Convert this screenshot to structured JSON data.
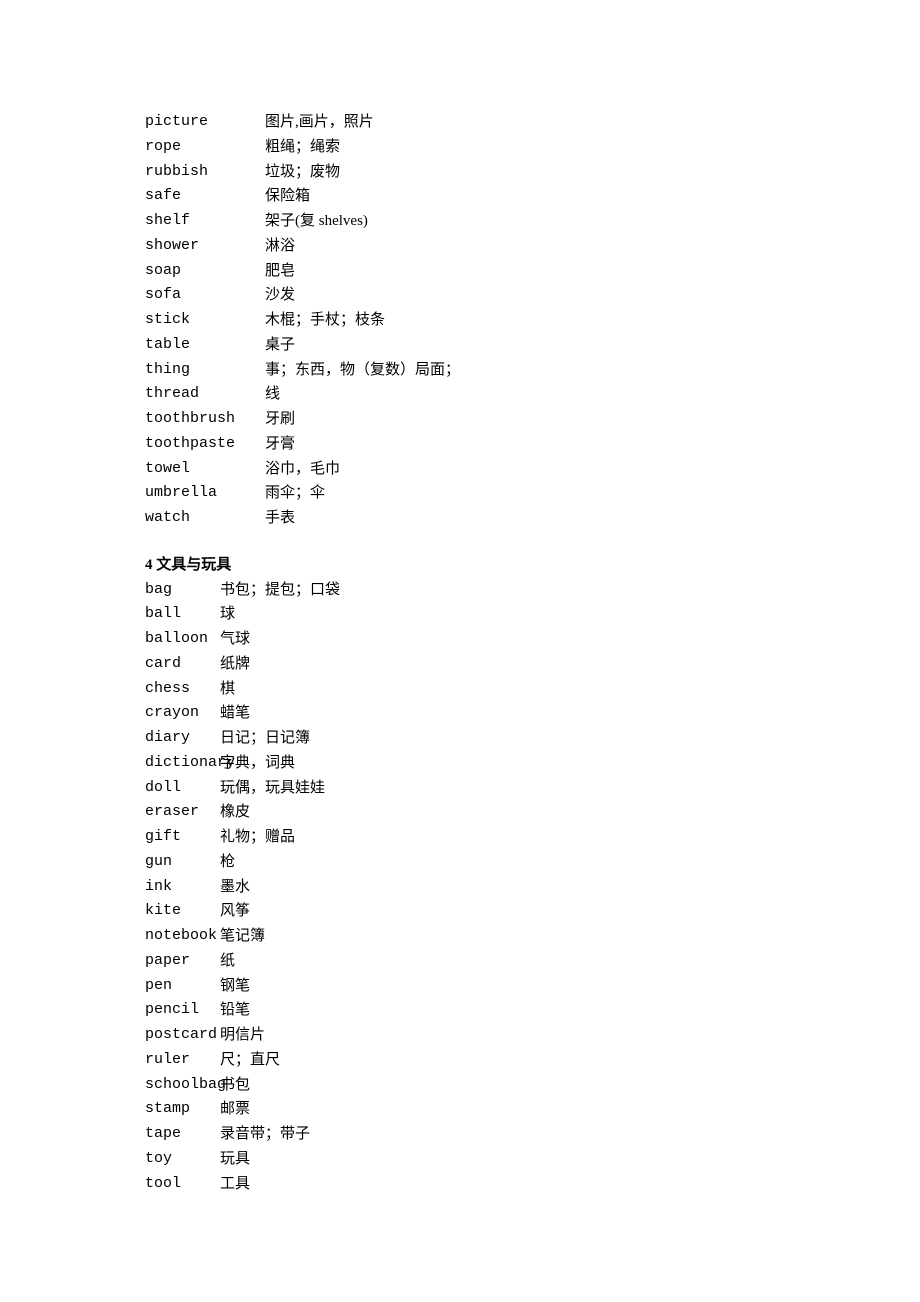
{
  "section1": {
    "entries": [
      {
        "term": "picture",
        "def": "图片,画片，照片"
      },
      {
        "term": "rope",
        "def": "粗绳；绳索"
      },
      {
        "term": "rubbish",
        "def": "垃圾；废物"
      },
      {
        "term": "safe",
        "def": "保险箱"
      },
      {
        "term": "shelf",
        "def": "架子(复 shelves)"
      },
      {
        "term": "shower",
        "def": "淋浴"
      },
      {
        "term": "soap",
        "def": "肥皂"
      },
      {
        "term": "sofa",
        "def": "沙发"
      },
      {
        "term": "stick",
        "def": "木棍；手杖；枝条"
      },
      {
        "term": "table",
        "def": "桌子"
      },
      {
        "term": "thing",
        "def": "事；东西，物（复数）局面；"
      },
      {
        "term": "thread",
        "def": "线"
      },
      {
        "term": "toothbrush",
        "def": "牙刷"
      },
      {
        "term": "toothpaste",
        "def": "牙膏"
      },
      {
        "term": "towel",
        "def": "浴巾，毛巾"
      },
      {
        "term": "umbrella",
        "def": "雨伞；伞"
      },
      {
        "term": "watch",
        "def": "手表"
      }
    ]
  },
  "section2": {
    "heading": "4 文具与玩具",
    "entries": [
      {
        "term": "bag",
        "def": "书包；提包；口袋"
      },
      {
        "term": "ball",
        "def": "球"
      },
      {
        "term": "balloon",
        "def": "气球"
      },
      {
        "term": "card",
        "def": "纸牌"
      },
      {
        "term": "chess",
        "def": "棋"
      },
      {
        "term": "crayon",
        "def": "蜡笔"
      },
      {
        "term": "diary",
        "def": "日记；日记簿"
      },
      {
        "term": "dictionary",
        "def": "字典，词典"
      },
      {
        "term": "doll",
        "def": "玩偶，玩具娃娃"
      },
      {
        "term": "eraser",
        "def": "橡皮"
      },
      {
        "term": "gift",
        "def": "礼物；赠品"
      },
      {
        "term": "gun",
        "def": "枪"
      },
      {
        "term": "ink",
        "def": "墨水"
      },
      {
        "term": "kite",
        "def": "风筝"
      },
      {
        "term": "notebook",
        "def": "笔记簿"
      },
      {
        "term": "paper",
        "def": "纸"
      },
      {
        "term": "pen",
        "def": "钢笔"
      },
      {
        "term": "pencil",
        "def": "铅笔"
      },
      {
        "term": "postcard",
        "def": "明信片"
      },
      {
        "term": "ruler",
        "def": "尺；直尺"
      },
      {
        "term": "schoolbag",
        "def": "书包"
      },
      {
        "term": "stamp",
        "def": "邮票"
      },
      {
        "term": "tape",
        "def": "录音带；带子"
      },
      {
        "term": "toy",
        "def": "玩具"
      },
      {
        "term": "tool",
        "def": "工具"
      }
    ]
  }
}
